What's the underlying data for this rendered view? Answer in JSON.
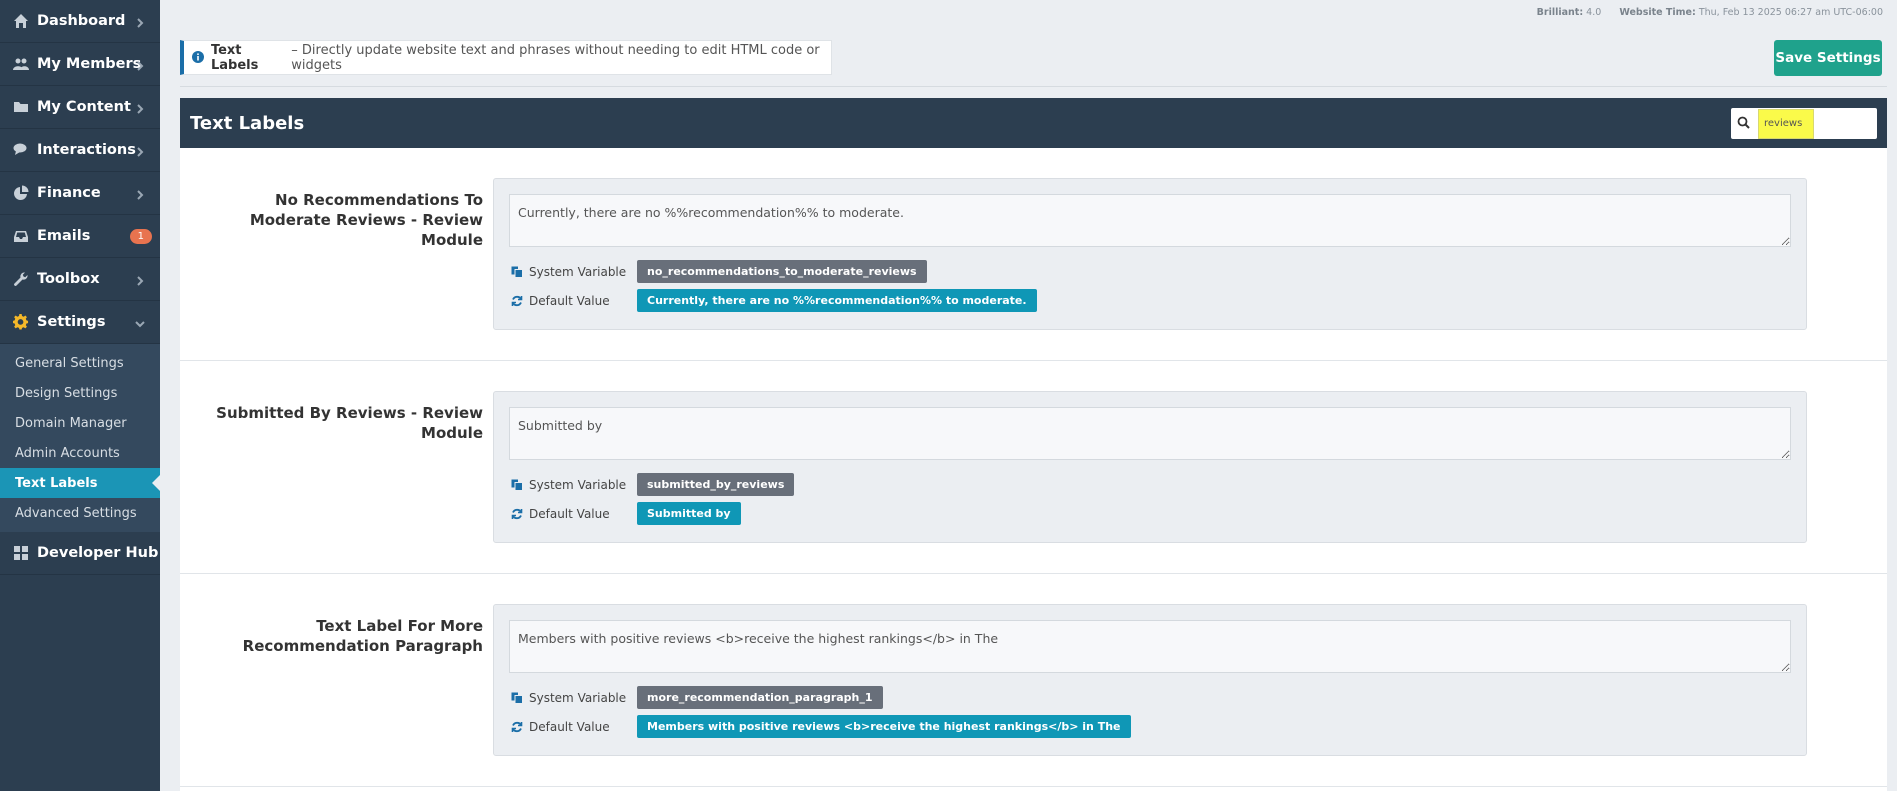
{
  "sidebar": {
    "items": [
      {
        "label": "Dashboard",
        "icon": "home-icon"
      },
      {
        "label": "My Members",
        "icon": "users-icon"
      },
      {
        "label": "My Content",
        "icon": "folder-icon"
      },
      {
        "label": "Interactions",
        "icon": "comments-icon"
      },
      {
        "label": "Finance",
        "icon": "pie-chart-icon"
      },
      {
        "label": "Emails",
        "icon": "inbox-icon",
        "badge": "1"
      },
      {
        "label": "Toolbox",
        "icon": "wrench-icon"
      },
      {
        "label": "Settings",
        "icon": "gear-icon"
      }
    ],
    "settings_sub": [
      "General Settings",
      "Design Settings",
      "Domain Manager",
      "Admin Accounts",
      "Text Labels",
      "Advanced Settings"
    ],
    "developer_hub": "Developer Hub"
  },
  "topinfo": {
    "version_label": "Brilliant:",
    "version_value": "4.0",
    "time_label": "Website Time:",
    "time_value": "Thu, Feb 13 2025 06:27 am UTC-06:00"
  },
  "info": {
    "title": "Text Labels",
    "desc": "– Directly update website text and phrases without needing to edit HTML code or widgets"
  },
  "save_label": "Save Settings",
  "panel": {
    "title": "Text Labels",
    "search_value": "reviews"
  },
  "meta_labels": {
    "system_variable": "System Variable",
    "default_value": "Default Value"
  },
  "rows": [
    {
      "label": "No Recommendations To Moderate Reviews - Review Module",
      "value": "Currently, there are no %%recommendation%% to moderate.",
      "system_variable": "no_recommendations_to_moderate_reviews",
      "default_value": "Currently, there are no %%recommendation%% to moderate."
    },
    {
      "label": "Submitted By Reviews - Review Module",
      "value": "Submitted by",
      "system_variable": "submitted_by_reviews",
      "default_value": "Submitted by"
    },
    {
      "label": "Text Label For More Recommendation Paragraph",
      "value": "Members with positive reviews <b>receive the highest rankings</b> in The",
      "system_variable": "more_recommendation_paragraph_1",
      "default_value": "Members with positive reviews <b>receive the highest rankings</b> in The"
    }
  ],
  "colors": {
    "sidebar": "#2c3e50",
    "accent": "#1b95b6",
    "save": "#1fa28c",
    "badge": "#e8734f"
  }
}
